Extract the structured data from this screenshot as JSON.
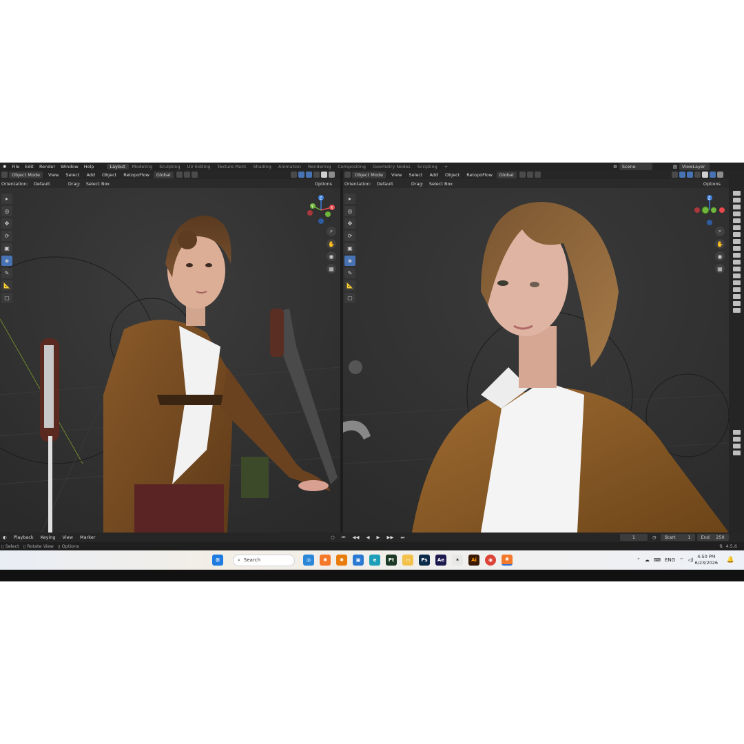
{
  "menubar": {
    "menus": [
      "File",
      "Edit",
      "Render",
      "Window",
      "Help"
    ],
    "workspaces": [
      "Layout",
      "Modeling",
      "Sculpting",
      "UV Editing",
      "Texture Paint",
      "Shading",
      "Animation",
      "Rendering",
      "Compositing",
      "Geometry Nodes",
      "Scripting"
    ],
    "active_workspace": "Layout",
    "add_workspace": "+",
    "scene": "Scene",
    "view_layer": "ViewLayer"
  },
  "viewport_left": {
    "mode": "Object Mode",
    "menus": [
      "View",
      "Select",
      "Add",
      "Object"
    ],
    "addon": "RetopoFlow",
    "transform": "Global",
    "orientation_label": "Orientation:",
    "orientation": "Default",
    "drag_label": "Drag:",
    "drag": "Select Box",
    "options": "Options",
    "gizmo": {
      "z": "Z",
      "y": "Y",
      "x": "X"
    }
  },
  "viewport_right": {
    "mode": "Object Mode",
    "menus": [
      "View",
      "Select",
      "Add",
      "Object"
    ],
    "addon": "RetopoFlow",
    "transform": "Global",
    "orientation_label": "Orientation:",
    "orientation": "Default",
    "drag_label": "Drag:",
    "drag": "Select Box",
    "options": "Options",
    "gizmo": {
      "z": "Z"
    }
  },
  "timeline": {
    "menus": [
      "Playback",
      "Keying",
      "View",
      "Marker"
    ],
    "current_frame": "1",
    "start_label": "Start",
    "start": "1",
    "end_label": "End",
    "end": "250"
  },
  "statusbar": {
    "select": "Select",
    "rotate": "Rotate View",
    "options": "Options",
    "version": "4.5.6"
  },
  "taskbar": {
    "search_placeholder": "Search",
    "lang": "ENG",
    "time": "4:50 PM",
    "date": "6/23/2026",
    "apps": [
      "Ps",
      "Ae",
      "Ai",
      "Pt"
    ]
  },
  "colors": {
    "blender_bg": "#2f2f2f",
    "active_blue": "#4772b3",
    "gizmo_x": "#e8484e",
    "gizmo_y": "#6fb63a",
    "gizmo_z": "#3d7fdc"
  }
}
